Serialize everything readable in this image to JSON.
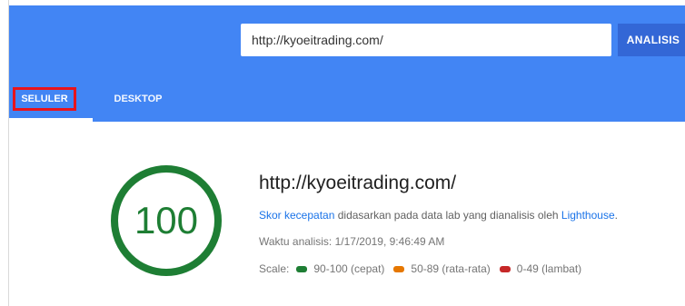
{
  "header": {
    "url_value": "http://kyoeitrading.com/",
    "analyze_label": "ANALISIS",
    "bg_color": "#4285f4",
    "button_color": "#3367d6"
  },
  "tabs": [
    {
      "label": "SELULER",
      "selected": true,
      "highlighted": true,
      "highlight_color": "#e8141c"
    },
    {
      "label": "DESKTOP",
      "selected": false
    }
  ],
  "result": {
    "score": "100",
    "score_fraction": 1.0,
    "score_color": "#1e7e34",
    "url": "http://kyoeitrading.com/",
    "desc": {
      "link1": "Skor kecepatan",
      "middle": " didasarkan pada data lab yang dianalisis oleh ",
      "link2": "Lighthouse",
      "end": "."
    },
    "timestamp": "Waktu analisis: 1/17/2019, 9:46:49 AM",
    "scale": {
      "label": "Scale:",
      "items": [
        {
          "range": "90-100 (cepat)",
          "color": "#1e7e34",
          "icon": "green-pill"
        },
        {
          "range": "50-89 (rata-rata)",
          "color": "#e67700",
          "icon": "orange-pill"
        },
        {
          "range": "0-49 (lambat)",
          "color": "#c62828",
          "icon": "red-pill"
        }
      ]
    }
  }
}
